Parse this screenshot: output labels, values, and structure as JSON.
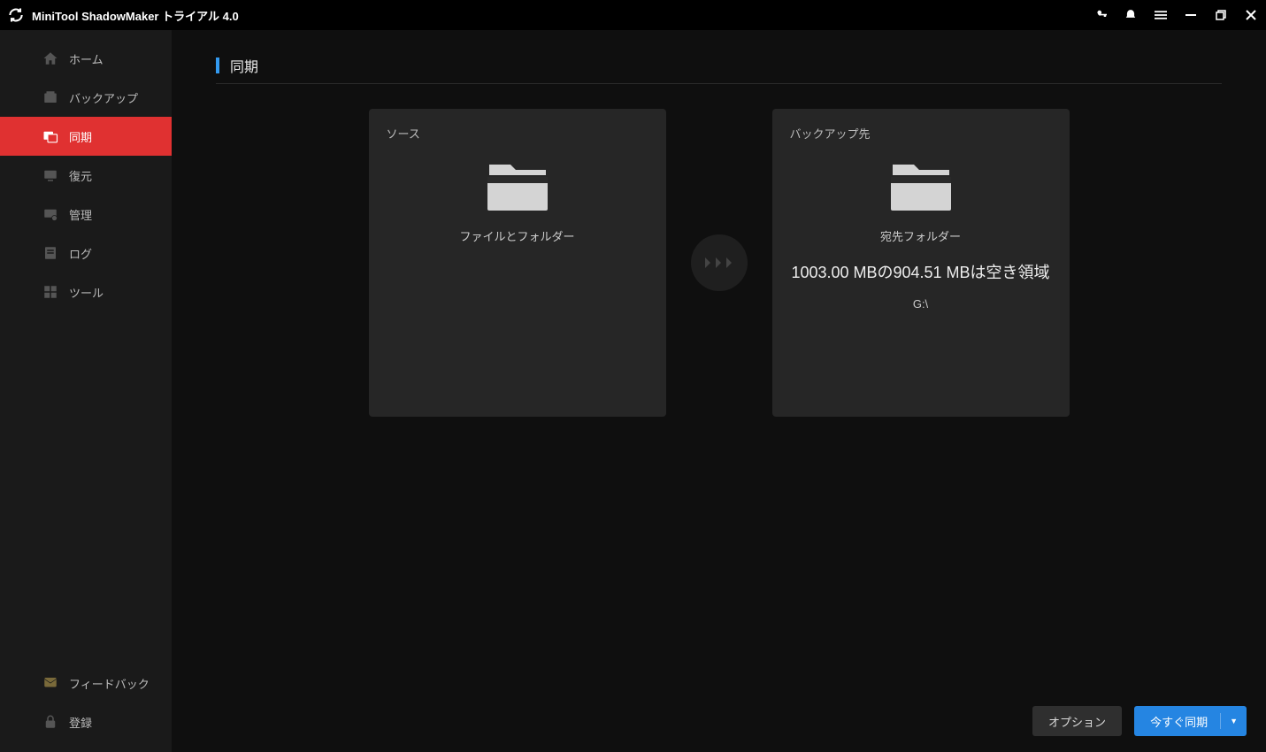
{
  "titlebar": {
    "product": "MiniTool ShadowMaker",
    "edition": "トライアル 4.0"
  },
  "sidebar": {
    "items": [
      {
        "label": "ホーム"
      },
      {
        "label": "バックアップ"
      },
      {
        "label": "同期"
      },
      {
        "label": "復元"
      },
      {
        "label": "管理"
      },
      {
        "label": "ログ"
      },
      {
        "label": "ツール"
      }
    ],
    "bottom": [
      {
        "label": "フィードバック"
      },
      {
        "label": "登録"
      }
    ]
  },
  "page": {
    "title": "同期",
    "source": {
      "label": "ソース",
      "caption": "ファイルとフォルダー"
    },
    "destination": {
      "label": "バックアップ先",
      "caption": "宛先フォルダー",
      "storage_info": "1003.00 MBの904.51 MBは空き領域",
      "path": "G:\\"
    }
  },
  "footer": {
    "options_label": "オプション",
    "sync_now_label": "今すぐ同期"
  }
}
